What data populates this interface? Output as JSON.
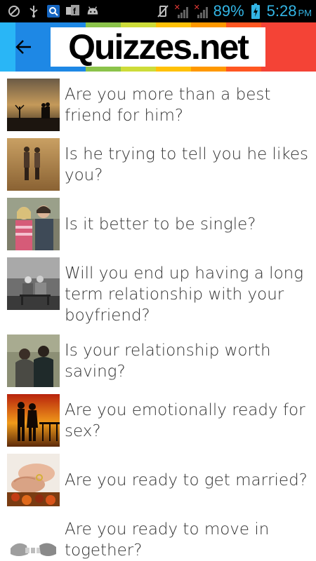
{
  "status_bar": {
    "battery_percent": "89%",
    "time": "5:28",
    "ampm": "PM",
    "accent_color": "#33b5e5"
  },
  "header": {
    "logo_text": "Quizzes.net",
    "back_icon": "arrow-left-icon",
    "stripe_colors": [
      "#29b6f6",
      "#1e88e5",
      "#8bc34a",
      "#cddc39",
      "#ffc107",
      "#ff9800",
      "#ff5722",
      "#f44336",
      "#e91e63"
    ]
  },
  "quizzes": [
    {
      "title": "Are you more than a best friend for him?"
    },
    {
      "title": "Is he trying to tell you he likes you?"
    },
    {
      "title": "Is it better to be single?"
    },
    {
      "title": "Will you end up having a long term relationship with your boyfriend?"
    },
    {
      "title": "Is your relationship worth saving?"
    },
    {
      "title": "Are you emotionally ready for sex?"
    },
    {
      "title": "Are you ready to get married?"
    },
    {
      "title": "Are you ready to move in together?"
    }
  ]
}
